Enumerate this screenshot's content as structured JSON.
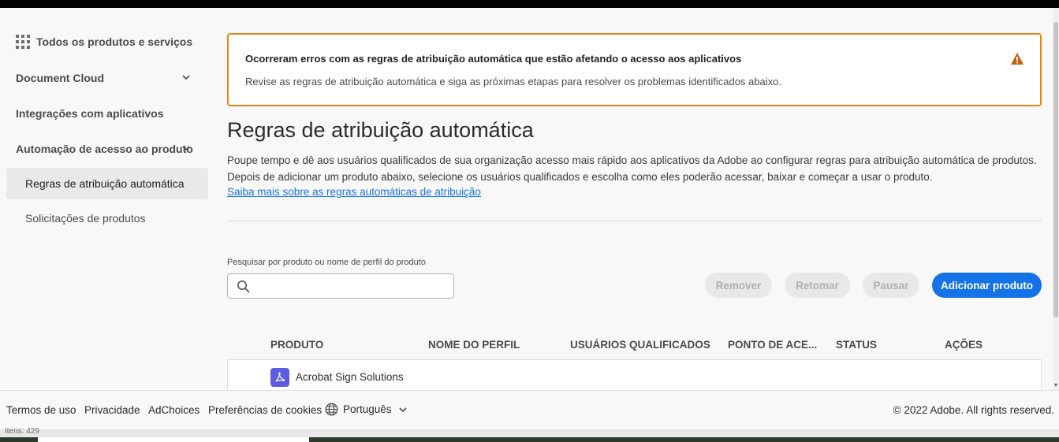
{
  "sidebar": {
    "items": [
      {
        "label": "Todos os produtos e serviços",
        "icon": "grid-icon"
      },
      {
        "label": "Document Cloud",
        "icon": "chevron-down-icon"
      },
      {
        "label": "Integrações com aplicativos"
      },
      {
        "label": "Automação de acesso ao produto",
        "icon": "chevron-down-icon"
      },
      {
        "label": "Regras de atribuição automática",
        "selected": true
      },
      {
        "label": "Solicitações de produtos"
      }
    ]
  },
  "alert": {
    "title": "Ocorreram erros com as regras de atribuição automática que estão afetando o acesso aos aplicativos",
    "text": "Revise as regras de atribuição automática e siga as próximas etapas para resolver os problemas identificados abaixo.",
    "icon": "alert-triangle-icon",
    "color": "#e68619"
  },
  "page": {
    "title": "Regras de atribuição automática",
    "description": "Poupe tempo e dê aos usuários qualificados de sua organização acesso mais rápido aos aplicativos da Adobe ao configurar regras para atribuição automática de produtos. Depois de adicionar um produto abaixo, selecione os usuários qualificados e escolha como eles poderão acessar, baixar e começar a usar o produto.",
    "learn_more": "Saiba mais sobre as regras automáticas de atribuição"
  },
  "search": {
    "label": "Pesquisar por produto ou nome de perfil do produto",
    "value": "",
    "placeholder": ""
  },
  "actions": {
    "remove": "Remover",
    "resume": "Retomar",
    "pause": "Pausar",
    "add": "Adicionar produto",
    "accent": "#1473e6"
  },
  "table": {
    "headers": [
      "PRODUTO",
      "NOME DO PERFIL",
      "USUÁRIOS QUALIFICADOS",
      "PONTO DE ACE...",
      "STATUS",
      "AÇÕES"
    ],
    "rows": [
      {
        "product": "Acrobat Sign Solutions",
        "icon": "acrobat-sign-icon"
      }
    ]
  },
  "footer": {
    "terms": "Termos de uso",
    "privacy": "Privacidade",
    "adchoices": "AdChoices",
    "cookies": "Preferências de cookies",
    "language": "Português",
    "copyright": "© 2022 Adobe. All rights reserved."
  },
  "status_bar": {
    "text": "Itens: 429"
  }
}
